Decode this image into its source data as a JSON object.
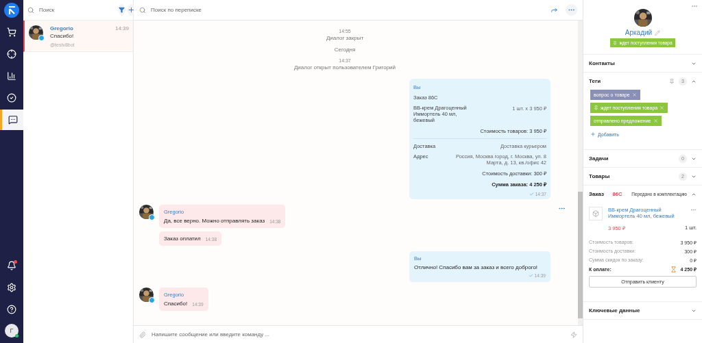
{
  "nav": {
    "items": [
      {
        "kind": "cart",
        "selected": false
      },
      {
        "kind": "target",
        "selected": false
      },
      {
        "kind": "chart",
        "selected": false
      },
      {
        "kind": "tasks",
        "selected": false
      },
      {
        "kind": "chats",
        "selected": true
      }
    ],
    "bottom": [
      {
        "kind": "bell",
        "alert": true
      },
      {
        "kind": "settings",
        "alert": false
      },
      {
        "kind": "help",
        "alert": false
      }
    ],
    "user": {
      "initial": "Г",
      "online": true
    }
  },
  "chat_list": {
    "search": {
      "placeholder": "Поиск"
    },
    "conversations": [
      {
        "name": "Gregorio",
        "time": "14:39",
        "text": "Спасибо!",
        "handle": "@testv8bot",
        "selected": true
      }
    ]
  },
  "chat": {
    "search": {
      "placeholder": "Поиск по переписке"
    },
    "messages": [
      {
        "kind": "system",
        "time": "14:55",
        "text": "Диалог закрыт"
      },
      {
        "kind": "date",
        "text": "Сегодня"
      },
      {
        "kind": "system",
        "time": "14:37",
        "text": "Диалог открыт пользователем Григорий"
      },
      {
        "kind": "order",
        "sender": "Вы",
        "title": "Заказ 86С",
        "item_name": "BB-крем Драгоценный Иммортель 40 мл, бежевый",
        "item_qty": "1 шт. x 3 950 ₽",
        "goods_total": "Стоимость товаров: 3 950 ₽",
        "delivery_label": "Доставка",
        "delivery_value": "Доставка курьером",
        "address_label": "Адрес",
        "address_value": "Россия, Москва город, г. Москва, ул. 8 Марта, д. 13, кв./офис 42",
        "delivery_cost": "Стоимость доставки: 300 ₽",
        "total": "Сумма заказа: 4 250 ₽",
        "time": "14:37",
        "read": true
      },
      {
        "kind": "incoming",
        "sender": "Gregorio",
        "menu": true,
        "bubbles": [
          {
            "text": "Да, все верно. Можно отправлять заказ",
            "time": "14:38"
          },
          {
            "text": "Заказ оплатил",
            "time": "14:38"
          }
        ]
      },
      {
        "kind": "outgoing",
        "sender": "Вы",
        "text": "Отлично! Спасибо вам за заказ и всего доброго!",
        "time": "14:39",
        "read": true
      },
      {
        "kind": "incoming",
        "sender": "Gregorio",
        "menu": false,
        "bubbles": [
          {
            "text": "Спасибо!",
            "time": "14:39"
          }
        ]
      }
    ],
    "composer": {
      "placeholder": "Напишите сообщение или введите команду ..."
    }
  },
  "contact": {
    "name": "Аркадий",
    "status_tag": {
      "label": "ждет поступления товара",
      "color": "#8cc63f"
    },
    "sections": [
      {
        "kind": "plain",
        "title": "Контакты",
        "expanded": false
      },
      {
        "kind": "tags",
        "title": "Теги",
        "count": "3",
        "expanded": true,
        "tags": [
          {
            "label": "вопрос о товаре",
            "color": "#8a8fb5",
            "pinned": false
          },
          {
            "label": "ждет поступления товара",
            "color": "#8cc63f",
            "pinned": true
          },
          {
            "label": "отправлено предложение",
            "color": "#8cc63f",
            "pinned": false
          }
        ],
        "add": "Добавить"
      },
      {
        "kind": "plain",
        "title": "Задачи",
        "count": "0",
        "expanded": false
      },
      {
        "kind": "plain",
        "title": "Товары",
        "count": "2",
        "expanded": false
      },
      {
        "kind": "order",
        "title": "Заказ",
        "number": "86С",
        "status": "Передано в комплектацию",
        "expanded": true,
        "item": {
          "name": "BB-крем Драгоценный Иммортель 40 мл, бежевый",
          "price": "3 950 ₽",
          "qty": "1 шт."
        },
        "summary": [
          {
            "label": "Стоимость товаров:",
            "value": "3 950 ₽"
          },
          {
            "label": "Стоимость доставки:",
            "value": "300 ₽"
          },
          {
            "label": "Сумма скидок по заказу:",
            "value": "0 ₽"
          }
        ],
        "pay_label": "К оплате:",
        "pay_value": "4 250 ₽",
        "button": "Отправить клиенту"
      },
      {
        "kind": "plain",
        "title": "Ключевые данные",
        "expanded": false
      }
    ]
  }
}
